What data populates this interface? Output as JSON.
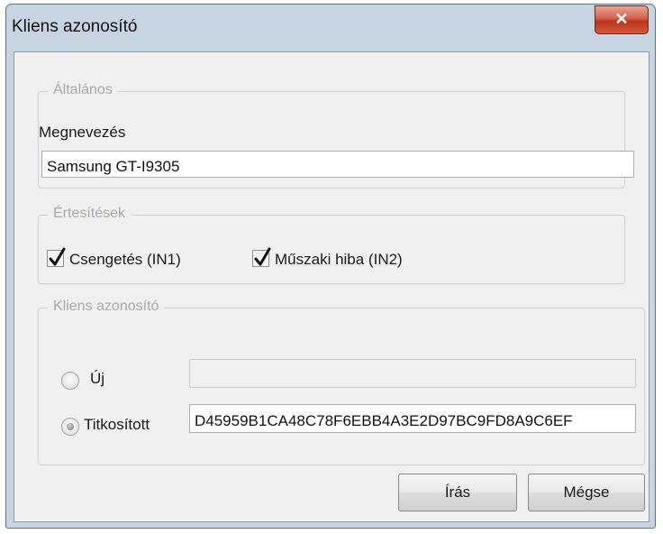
{
  "window": {
    "title": "Kliens azonosító",
    "close_glyph": "✕"
  },
  "general": {
    "legend": "Általános",
    "name_label": "Megnevezés",
    "name_value": "Samsung GT-I9305"
  },
  "notifications": {
    "legend": "Értesítések",
    "items": [
      {
        "label": "Csengetés (IN1)",
        "checked": true
      },
      {
        "label": "Műszaki hiba (IN2)",
        "checked": true
      }
    ]
  },
  "client_id": {
    "legend": "Kliens azonosító",
    "new_label": "Új",
    "new_value": "",
    "encrypted_label": "Titkosított",
    "encrypted_value": "D45959B1CA48C78F6EBB4A3E2D97BC9FD8A9C6EF",
    "selected": "encrypted"
  },
  "buttons": {
    "write": "Írás",
    "cancel": "Mégse"
  }
}
